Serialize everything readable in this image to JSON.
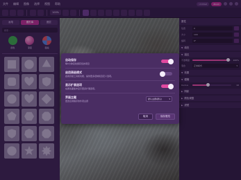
{
  "menubar": {
    "items": [
      "文件",
      "编辑",
      "图像",
      "选择",
      "视图",
      "帮助"
    ],
    "chips": [
      "Untitled",
      "Zoom"
    ]
  },
  "toolbar": {
    "zoom": "100%"
  },
  "left_panel": {
    "tabs": [
      "画笔",
      "图形库",
      "图层"
    ],
    "search_placeholder": "搜索...",
    "swatches": [
      {
        "label": "颜色",
        "color": "#3aa14a"
      },
      {
        "label": "渐变",
        "color": "#c24e9a"
      },
      {
        "label": "图案",
        "color": "#4e7fd6"
      }
    ],
    "shapes": [
      "square",
      "circle",
      "triangle",
      "rounded-square",
      "heart",
      "shield",
      "circle",
      "heart",
      "diamond",
      "pentagon",
      "hexagon",
      "octagon",
      "shield",
      "heptagon",
      "octagon",
      "circle",
      "star",
      "burst"
    ]
  },
  "right_panel": {
    "header": "属性",
    "rows": [
      {
        "label": "位置",
        "value": "0"
      },
      {
        "label": "大小",
        "value": "100"
      },
      {
        "label": "旋转",
        "value": "0°"
      }
    ],
    "section_fill": "填充",
    "section_stroke": "描边",
    "opacity_label": "不透明度",
    "opacity_value": "100%",
    "blend_label": "混合",
    "blend_value": "正常模式",
    "section_effects": "效果",
    "section_blur": "模糊",
    "radius_label": "Radius",
    "radius_value": "10",
    "section_more": [
      "阴影",
      "颜色调整",
      "滤镜"
    ]
  },
  "dialog": {
    "settings": [
      {
        "title": "自动保存",
        "desc": "每5分钟自动保存您的项目",
        "state": "on"
      },
      {
        "title": "启用高级模式",
        "desc": "启用高级工具和功能，提供更多控制和自定义选项。",
        "state": "off"
      },
      {
        "title": "显示扩展选项",
        "desc": "在属性面板中显示更多扩展选项。",
        "state": "on"
      }
    ],
    "theme_title": "界面主题",
    "theme_desc": "更改应用程序的外观主题",
    "theme_value": "默认主题(默认)",
    "cancel_label": "取消",
    "save_label": "保存更改"
  },
  "colors": {
    "accent": "#e04aa0",
    "panel": "#3b2452",
    "dialog": "#4a2d63"
  }
}
